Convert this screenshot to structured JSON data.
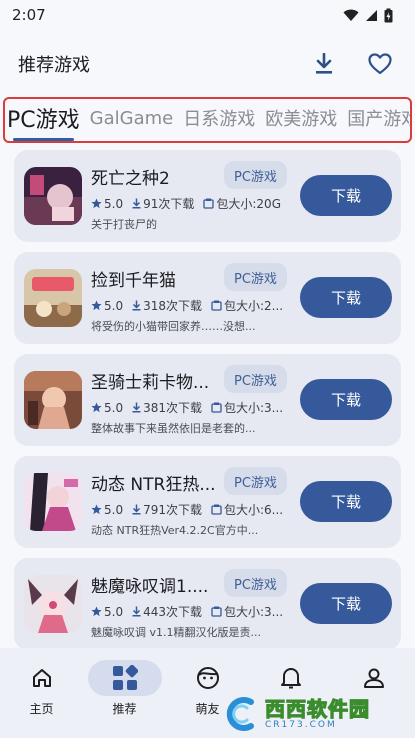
{
  "status_bar": {
    "time": "2:07"
  },
  "header": {
    "title": "推荐游戏",
    "download_icon": "download-icon",
    "favorite_icon": "heart-icon"
  },
  "tabs": [
    {
      "label": "PC游戏",
      "active": true
    },
    {
      "label": "GalGame",
      "active": false
    },
    {
      "label": "日系游戏",
      "active": false
    },
    {
      "label": "欧美游戏",
      "active": false
    },
    {
      "label": "国产游戏",
      "active": false
    }
  ],
  "games": [
    {
      "title": "死亡之种2",
      "badge": "PC游戏",
      "rating": "5.0",
      "downloads": "91次下载",
      "size": "包大小:20G",
      "desc": "关于打丧尸的",
      "button": "下载"
    },
    {
      "title": "捡到千年猫",
      "badge": "PC游戏",
      "rating": "5.0",
      "downloads": "318次下载",
      "size": "包大小:2...",
      "desc": "将受伤的小猫带回家养……没想...",
      "button": "下载"
    },
    {
      "title": "圣骑士莉卡物...",
      "badge": "PC游戏",
      "rating": "5.0",
      "downloads": "381次下载",
      "size": "包大小:3...",
      "desc": "整体故事下来虽然依旧是老套的...",
      "button": "下载"
    },
    {
      "title": "动态 NTR狂热...",
      "badge": "PC游戏",
      "rating": "5.0",
      "downloads": "791次下载",
      "size": "包大小:6...",
      "desc": "动态 NTR狂热Ver4.2.2C官方中...",
      "button": "下载"
    },
    {
      "title": "魅魔咏叹调1....",
      "badge": "PC游戏",
      "rating": "5.0",
      "downloads": "443次下载",
      "size": "包大小:3...",
      "desc": "魅魔咏叹调 v1.1精翻汉化版是责...",
      "button": "下载"
    }
  ],
  "bottom_nav": [
    {
      "label": "主页",
      "icon": "home-icon",
      "active": false
    },
    {
      "label": "推荐",
      "icon": "grid-icon",
      "active": true
    },
    {
      "label": "萌友",
      "icon": "face-icon",
      "active": false
    },
    {
      "label": "",
      "icon": "bell-icon",
      "active": false
    },
    {
      "label": "",
      "icon": "person-icon",
      "active": false
    }
  ],
  "watermark": {
    "text": "西西软件园",
    "sub": "CR173.COM"
  },
  "colors": {
    "accent": "#35599a",
    "badge_bg": "#d6dcea",
    "card_bg": "#e6e9f2",
    "highlight_border": "#d93c3c"
  }
}
